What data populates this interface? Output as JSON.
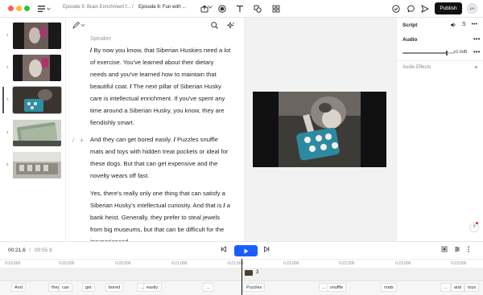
{
  "topbar": {
    "breadcrumb_1": "Episode 5: Brain Enrichment f...",
    "breadcrumb_sep": "/",
    "breadcrumb_2": "Episode 6: Fun with ...",
    "publish_label": "Publish",
    "avatar_initials": "LH"
  },
  "thumbnails": [
    {
      "number": "1"
    },
    {
      "number": "2"
    },
    {
      "number": "3"
    },
    {
      "number": "4"
    },
    {
      "number": "5"
    }
  ],
  "script": {
    "speaker": "Speaker",
    "para1_text": "By now you know, that Siberian Huskies need a lot of exercise. You've learned about their dietary needs and you've learned how to maintain that beautiful coat.",
    "para1_text2": "The next pillar of Siberian Husky care is intellectual enrichment. If you've spent any time around a Siberian Husky, you know, they are fiendishly smart.",
    "para2_text": "And they can get bored easily.",
    "para2_text2": "Puzzles snuffle mats and toys with hidden treat pockets or ideal for these dogs. But that can get expensive and the novelty wears off fast.",
    "para3_text": "Yes, there's really only one thing that can satisfy a Siberian Husky's intellectual curiosity. And that is",
    "para3_text2": "a bank heist. Generally, they prefer to steal jewels from big museums, but that can be difficult for the inexperienced",
    "gutter_mark": "/"
  },
  "right_panel": {
    "title": "Script",
    "audio_label": "Audio",
    "volume_value": "+0.0dB",
    "volume_level": 0.85,
    "effects_label": "Audio Effects"
  },
  "transport": {
    "current_time": "00:21.6",
    "separator": "/",
    "total_time": "00:55.9"
  },
  "ruler": {
    "ticks": [
      "0:19.500",
      "0:20.000",
      "0:20.500",
      "0:21.000",
      "0:21.500",
      "0:22.000",
      "0:22.500",
      "0:23.000",
      "0:23.500"
    ]
  },
  "cliptrack": {
    "clip_number": "3"
  },
  "words": [
    "And",
    "they",
    "can",
    "get",
    "bored",
    "...",
    "easily.",
    "...",
    "Puzzles",
    "...",
    "snuffle",
    "mats",
    "...",
    "and",
    "toys"
  ],
  "colors": {
    "accent": "#1a5dff",
    "publish_bg": "#111111"
  }
}
